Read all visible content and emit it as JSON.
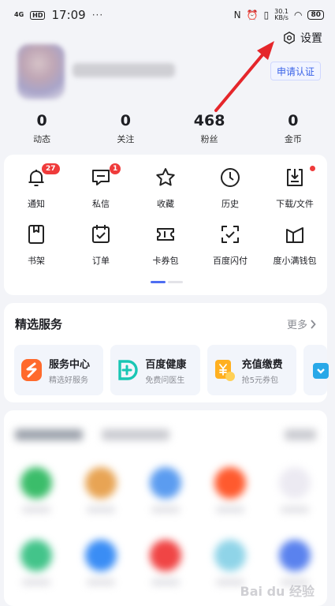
{
  "status_bar": {
    "signal": "4G",
    "hd": "HD",
    "time": "17:09",
    "dots": "···",
    "net_speed": "30.1",
    "net_unit": "KB/s",
    "battery": "80"
  },
  "header": {
    "settings_label": "设置",
    "verify_label": "申请认证"
  },
  "stats": [
    {
      "value": "0",
      "label": "动态"
    },
    {
      "value": "0",
      "label": "关注"
    },
    {
      "value": "468",
      "label": "粉丝"
    },
    {
      "value": "0",
      "label": "金币"
    }
  ],
  "shortcuts": [
    {
      "label": "通知",
      "icon": "bell-icon",
      "badge": "27"
    },
    {
      "label": "私信",
      "icon": "message-icon",
      "badge": "1"
    },
    {
      "label": "收藏",
      "icon": "star-icon"
    },
    {
      "label": "历史",
      "icon": "clock-icon"
    },
    {
      "label": "下载/文件",
      "icon": "download-icon",
      "dot": true
    },
    {
      "label": "书架",
      "icon": "bookshelf-icon"
    },
    {
      "label": "订单",
      "icon": "order-icon"
    },
    {
      "label": "卡券包",
      "icon": "ticket-icon"
    },
    {
      "label": "百度闪付",
      "icon": "scan-pay-icon"
    },
    {
      "label": "度小满钱包",
      "icon": "wallet-icon"
    }
  ],
  "services": {
    "title": "精选服务",
    "more": "更多",
    "items": [
      {
        "name": "服务中心",
        "sub": "精选好服务",
        "icon": "service-center-icon",
        "color": "#ff6a2c"
      },
      {
        "name": "百度健康",
        "sub": "免费问医生",
        "icon": "health-icon",
        "color": "#19c6b4"
      },
      {
        "name": "充值缴费",
        "sub": "抢5元券包",
        "icon": "recharge-icon",
        "color": "#ffb020"
      }
    ]
  },
  "watermark": "Bai du 经验"
}
